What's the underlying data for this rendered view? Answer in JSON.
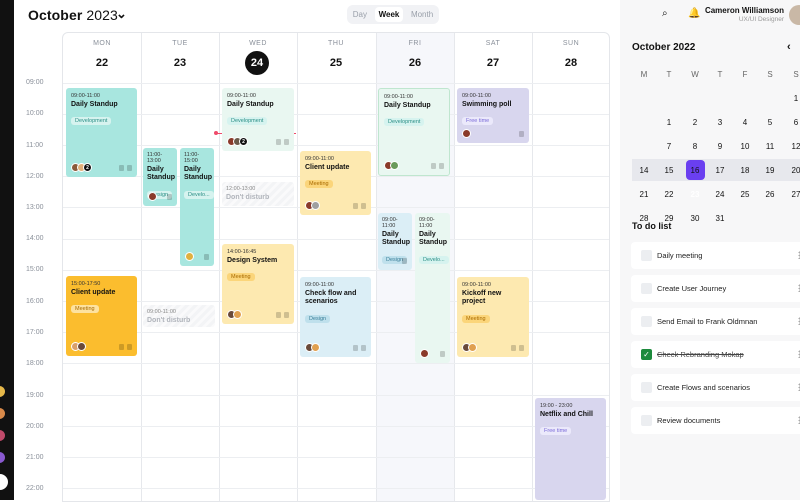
{
  "header": {
    "month": "October",
    "year": "2023",
    "view_tabs": [
      "Day",
      "Week",
      "Month"
    ],
    "active_view": "Week"
  },
  "days": [
    {
      "name": "MON",
      "num": "22"
    },
    {
      "name": "TUE",
      "num": "23"
    },
    {
      "name": "WED",
      "num": "24"
    },
    {
      "name": "THU",
      "num": "25"
    },
    {
      "name": "FRI",
      "num": "26"
    },
    {
      "name": "SAT",
      "num": "27"
    },
    {
      "name": "SUN",
      "num": "28"
    }
  ],
  "times": [
    "09:00",
    "10:00",
    "11:00",
    "12:00",
    "13:00",
    "14:00",
    "15:00",
    "16:00",
    "17:00",
    "18:00",
    "19:00",
    "20:00",
    "21:00",
    "22:00"
  ],
  "events": {
    "mon_standup": {
      "time": "09:00-11:00",
      "name": "Daily Standup",
      "tag": "Development",
      "count": "2"
    },
    "mon_client": {
      "time": "15:00-17:50",
      "name": "Client update",
      "tag": "Meeting"
    },
    "tue_standup": {
      "time": "11:00-13:00",
      "name": "Daily Standup",
      "tag": "Design"
    },
    "tue_disturb": {
      "time": "09:00-11:00",
      "name": "Don't disturb"
    },
    "tue_standup2": {
      "time": "11:00-15:00",
      "name": "Daily Standup",
      "tag": "Develo..."
    },
    "wed_standup": {
      "time": "09:00-11:00",
      "name": "Daily Standup",
      "tag": "Development",
      "count": "2"
    },
    "wed_disturb": {
      "time": "12:00-13:00",
      "name": "Don't disturb"
    },
    "wed_design": {
      "time": "14:00-16:45",
      "name": "Design System",
      "tag": "Meeting"
    },
    "thu_client": {
      "time": "09:00-11:00",
      "name": "Client update",
      "tag": "Meeting"
    },
    "thu_flow": {
      "time": "09:00-11:00",
      "name": "Check flow and scenarios",
      "tag": "Design"
    },
    "fri_standup": {
      "time": "09:00-11:00",
      "name": "Daily Standup",
      "tag": "Development"
    },
    "fri_standup_a": {
      "time": "09:00-11:00",
      "name": "Daily Standup",
      "tag": "Design"
    },
    "fri_standup_b": {
      "time": "09:00-11:00",
      "name": "Daily Standup",
      "tag": "Develo..."
    },
    "sat_swim": {
      "time": "09:00-11:00",
      "name": "Swimming poll",
      "tag": "Free time"
    },
    "sat_kickoff": {
      "time": "09:00-11:00",
      "name": "Kickoff new project",
      "tag": "Meeting"
    },
    "sun_netflix": {
      "time": "19:00 - 23:00",
      "name": "Netflix and Chill",
      "tag": "Free time"
    }
  },
  "user": {
    "name": "Cameron Williamson",
    "role": "UX/UI Designer"
  },
  "mini_calendar": {
    "title": "October 2022",
    "weekday_headers": [
      "M",
      "T",
      "W",
      "T",
      "F",
      "S",
      "S"
    ],
    "rows": [
      [
        "",
        "",
        "",
        "",
        "",
        "",
        "1"
      ],
      [
        "",
        "1",
        "2",
        "3",
        "4",
        "5",
        "6"
      ],
      [
        "",
        "7",
        "8",
        "9",
        "10",
        "11",
        "12"
      ],
      [
        "14",
        "15",
        "16",
        "17",
        "18",
        "19",
        "20"
      ],
      [
        "21",
        "22",
        "23",
        "24",
        "25",
        "26",
        "27"
      ],
      [
        "28",
        "29",
        "30",
        "31",
        "",
        "",
        ""
      ]
    ]
  },
  "todo": {
    "title": "To do list",
    "items": [
      {
        "label": "Daily meeting",
        "done": false
      },
      {
        "label": "Create User Journey",
        "done": false
      },
      {
        "label": "Send Email to Frank Oldmnan",
        "done": false
      },
      {
        "label": "Check Rebranding Mokap",
        "done": true
      },
      {
        "label": "Create Flows and scenarios",
        "done": false
      },
      {
        "label": "Review documents",
        "done": false
      }
    ]
  },
  "colors": {
    "teal": "#a8e6df",
    "orange": "#fbbd2e",
    "yellow": "#fde9b0",
    "lightblue": "#dbeef6",
    "mint": "#e9f7f1",
    "lavender": "#d8d6ee",
    "purple": "#6a3ff0",
    "now": "#ef4b6b"
  },
  "icons": {
    "search": "search-icon",
    "bell": "bell-icon",
    "check": "check-icon"
  }
}
